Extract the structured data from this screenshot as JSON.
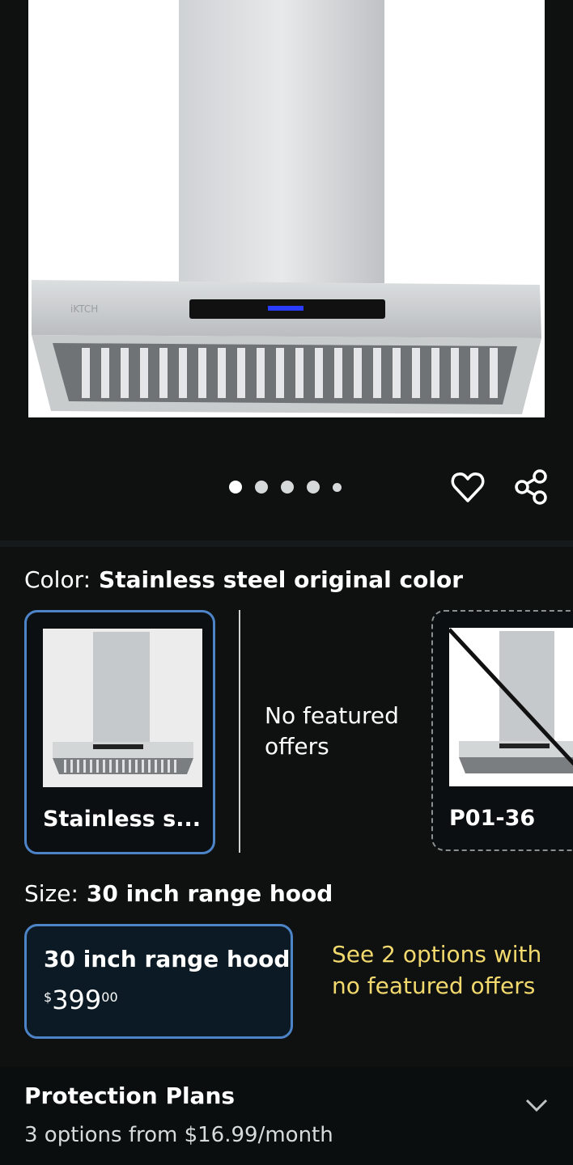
{
  "product": {
    "image_brand_text": "iKTCH",
    "carousel": {
      "count": 5,
      "active_index": 0
    }
  },
  "icons": {
    "favorite": "heart-icon",
    "share": "share-icon",
    "expand": "chevron-down-icon"
  },
  "color": {
    "label": "Color:",
    "selected": "Stainless steel original color",
    "options": [
      {
        "label": "Stainless s..."
      },
      {
        "label": "No featured offers"
      },
      {
        "label": "P01-36"
      }
    ]
  },
  "size": {
    "label": "Size:",
    "selected": "30 inch range hood",
    "option": {
      "title": "30 inch range hood",
      "currency": "$",
      "price_whole": "399",
      "price_fraction": "00"
    },
    "see_options": "See 2 options with no featured offers"
  },
  "protection": {
    "title": "Protection Plans",
    "subtitle": "3 options from $16.99/month"
  },
  "colors": {
    "accent_blue": "#4d84c8",
    "link_yellow": "#f2d96e",
    "background": "#0f1111"
  }
}
